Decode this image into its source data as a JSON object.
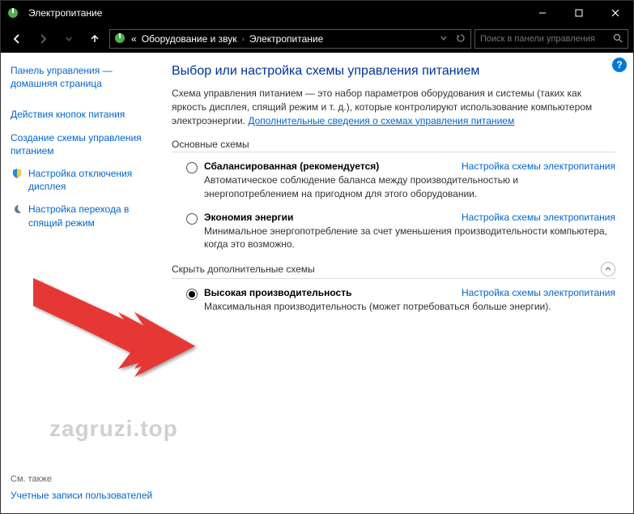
{
  "window": {
    "title": "Электропитание"
  },
  "breadcrumb": {
    "prefix": "«",
    "part1": "Оборудование и звук",
    "part2": "Электропитание"
  },
  "search": {
    "placeholder": "Поиск в панели управления"
  },
  "sidebar": {
    "home": "Панель управления — домашняя страница",
    "links": [
      {
        "label": "Действия кнопок питания",
        "icon": null
      },
      {
        "label": "Создание схемы управления питанием",
        "icon": null
      },
      {
        "label": "Настройка отключения дисплея",
        "icon": "shield"
      },
      {
        "label": "Настройка перехода в спящий режим",
        "icon": "moon"
      }
    ],
    "seealso": {
      "header": "См. также",
      "link": "Учетные записи пользователей"
    }
  },
  "main": {
    "heading": "Выбор или настройка схемы управления питанием",
    "intro_text": "Схема управления питанием — это набор параметров оборудования и системы (таких как яркость дисплея, спящий режим и т. д.), которые контролируют использование компьютером электроэнергии. ",
    "intro_link": "Дополнительные сведения о схемах управления питанием",
    "section_basic": "Основные схемы",
    "section_hide": "Скрыть дополнительные схемы",
    "config_label": "Настройка схемы электропитания",
    "plans": {
      "balanced": {
        "name": "Сбалансированная (рекомендуется)",
        "desc": "Автоматическое соблюдение баланса между производительностью и энергопотреблением на пригодном для этого оборудовании."
      },
      "saver": {
        "name": "Экономия энергии",
        "desc": "Минимальное энергопотребление за счет уменьшения производительности компьютера, когда это возможно."
      },
      "high": {
        "name": "Высокая производительность",
        "desc": "Максимальная производительность (может потребоваться больше энергии)."
      }
    }
  },
  "watermark": "zagruzi.top"
}
